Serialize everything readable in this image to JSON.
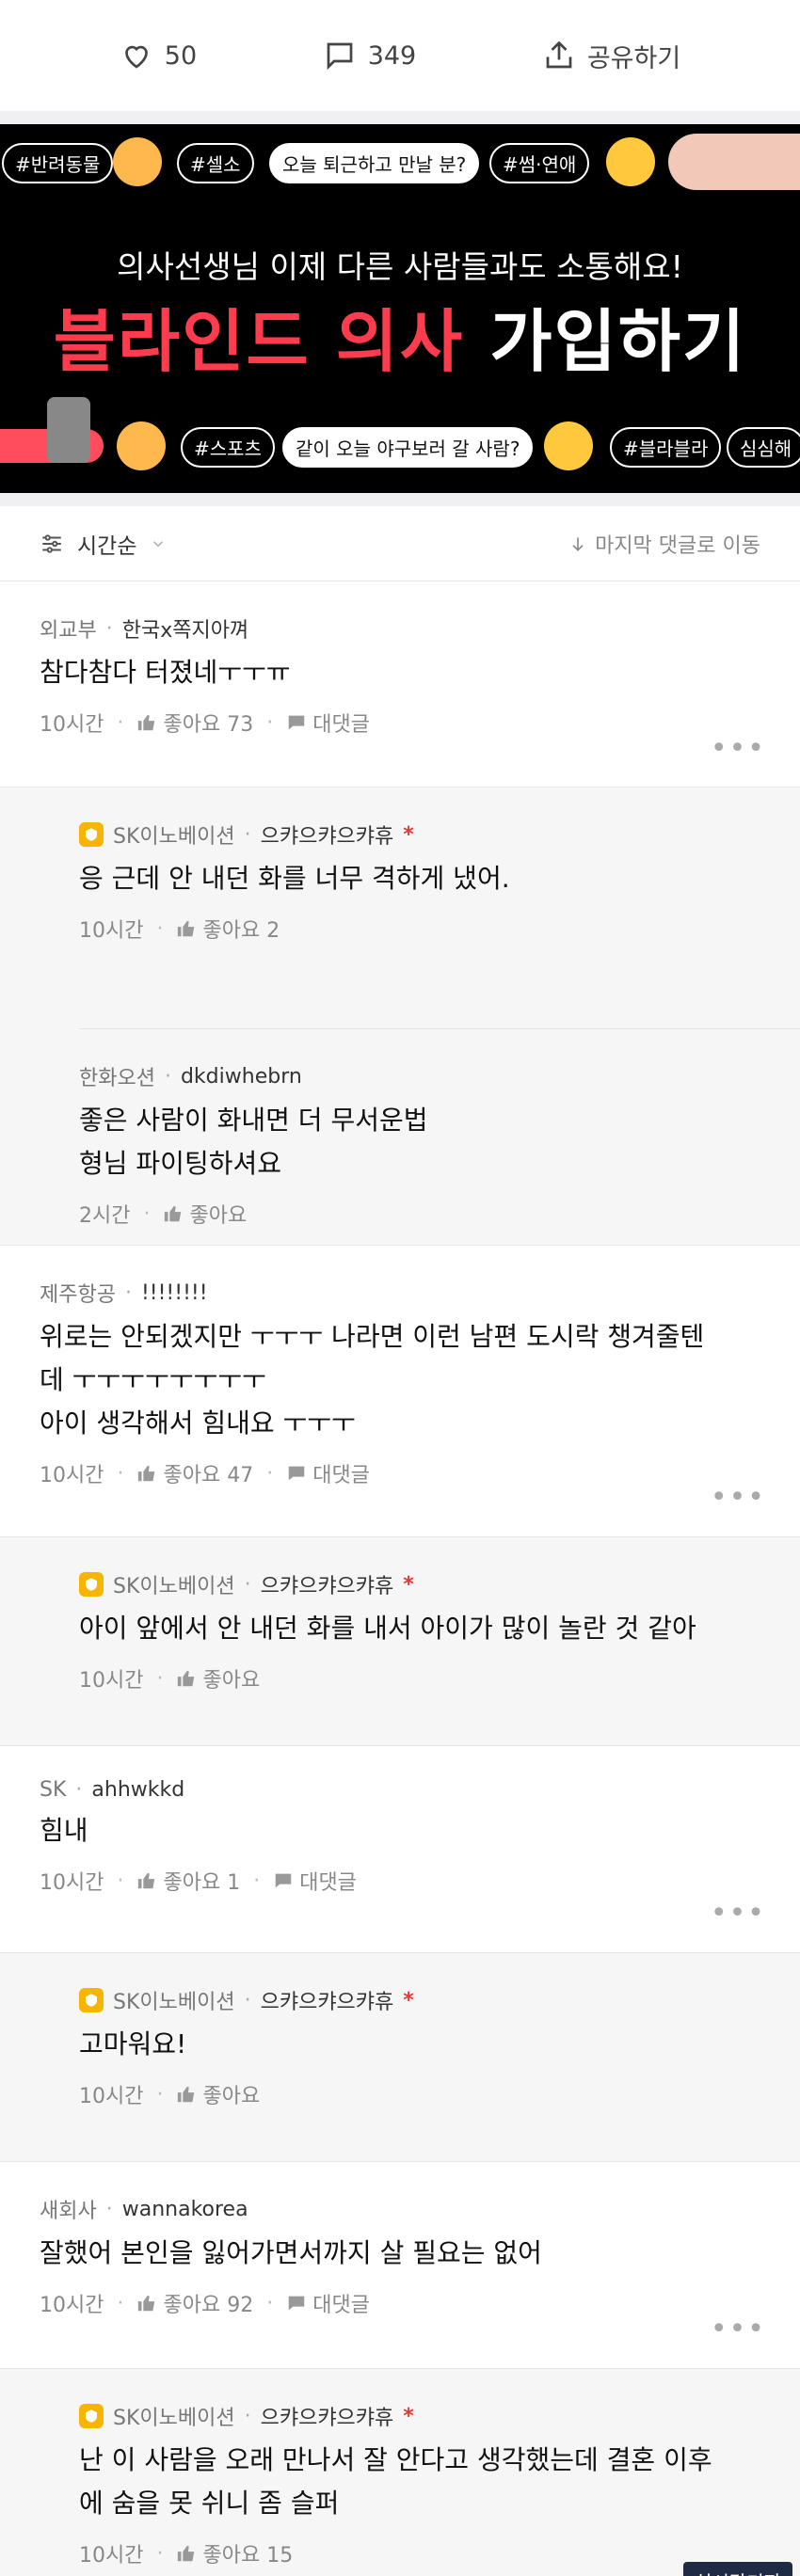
{
  "actions": {
    "likes": "50",
    "comments": "349",
    "share": "공유하기"
  },
  "banner": {
    "row1": [
      "#반려동물",
      "#셀소",
      "오늘 퇴근하고 만날 분?",
      "#썸·연애"
    ],
    "subtitle": "의사선생님 이제 다른 사람들과도 소통해요!",
    "title_red": "블라인드 의사",
    "title_white": "가입하기",
    "row2": [
      "#스포츠",
      "같이 오늘 야구보러 갈 사람?",
      "#블라블라",
      "심심해"
    ]
  },
  "sort": {
    "label": "시간순",
    "jump": "마지막 댓글로 이동"
  },
  "comments": [
    {
      "company": "외교부",
      "nick": "한국x쪽지아껴",
      "body": "참다참다 터졌네ㅜㅜㅠ",
      "time": "10시간",
      "likes": "좋아요 73",
      "reply": "대댓글"
    },
    {
      "company": "SK이노베이션",
      "nick": "으캬으캬으캬휴",
      "star": "*",
      "body": "응 근데 안 내던 화를 너무 격하게 냈어.",
      "time": "10시간",
      "likes": "좋아요 2"
    },
    {
      "company": "한화오션",
      "nick": "dkdiwhebrn",
      "body1": "좋은 사람이 화내면 더 무서운법",
      "body2": "형님 파이팅하셔요",
      "time": "2시간",
      "likes": "좋아요"
    },
    {
      "company": "제주항공",
      "nick": "!!!!!!!!",
      "body1": "위로는 안되겠지만 ㅜㅜㅜ 나라면 이런 남편 도시락 챙겨줄텐",
      "body2": "데 ㅜㅜㅜㅜㅜㅜㅜㅜ",
      "body3": "아이 생각해서 힘내요 ㅜㅜㅜ",
      "time": "10시간",
      "likes": "좋아요 47",
      "reply": "대댓글"
    },
    {
      "company": "SK이노베이션",
      "nick": "으캬으캬으캬휴",
      "star": "*",
      "body": "아이 앞에서 안 내던 화를 내서 아이가 많이 놀란 것 같아",
      "time": "10시간",
      "likes": "좋아요"
    },
    {
      "company": "SK",
      "nick": "ahhwkkd",
      "body": "힘내",
      "time": "10시간",
      "likes": "좋아요 1",
      "reply": "대댓글"
    },
    {
      "company": "SK이노베이션",
      "nick": "으캬으캬으캬휴",
      "star": "*",
      "body": "고마워요!",
      "time": "10시간",
      "likes": "좋아요"
    },
    {
      "company": "새회사",
      "nick": "wannakorea",
      "body": "잘했어 본인을 잃어가면서까지 살 필요는 없어",
      "time": "10시간",
      "likes": "좋아요 92",
      "reply": "대댓글"
    },
    {
      "company": "SK이노베이션",
      "nick": "으캬으캬으캬휴",
      "star": "*",
      "body1": "난 이 사람을 오래 만나서 잘 안다고 생각했는데 결혼 이후",
      "body2": "에 숨을 못 쉬니 좀 슬퍼",
      "time": "10시간",
      "likes": "좋아요 15"
    }
  ],
  "watermark": "실시간기자",
  "colors": {
    "accent_red": "#ff3b4e",
    "badge_gold": "#f7b500",
    "banner_bg": "#000000"
  }
}
